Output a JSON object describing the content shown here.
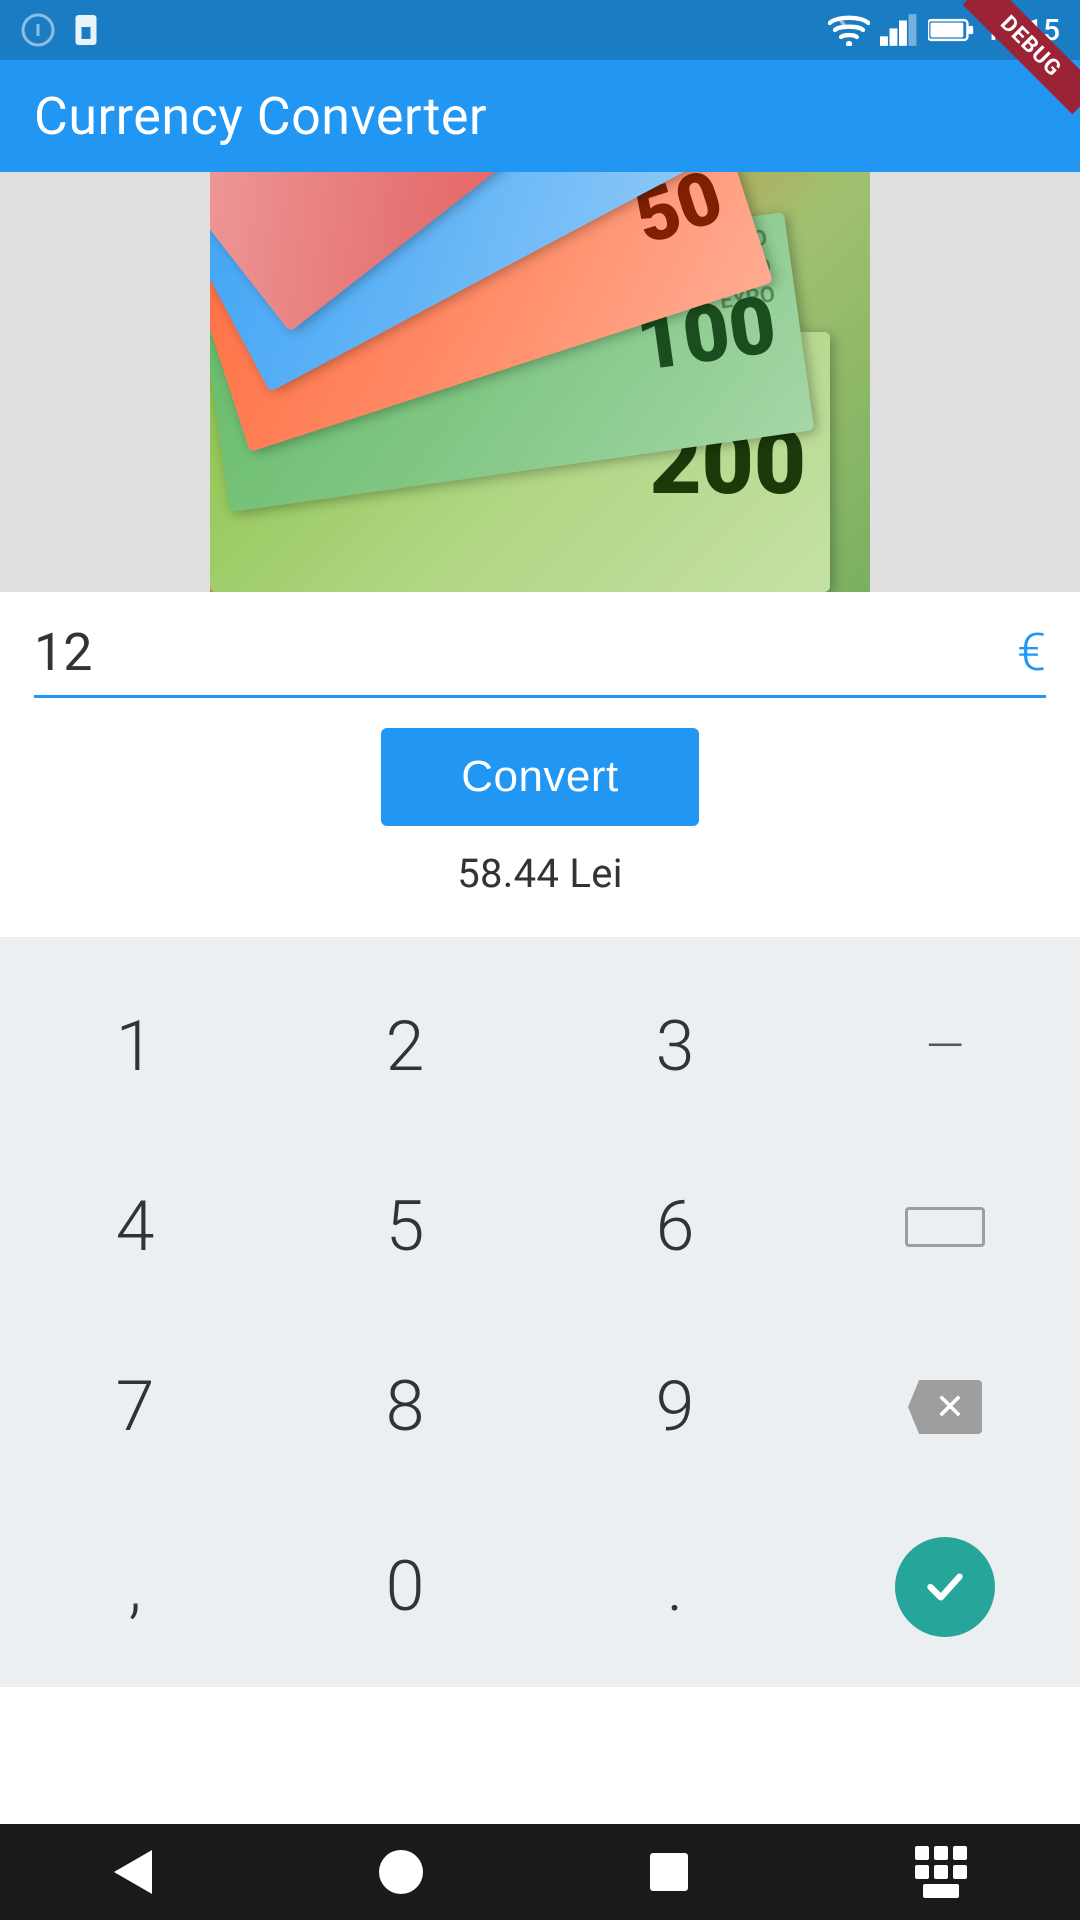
{
  "app": {
    "title": "Currency Converter",
    "debug_label": "DEBUG"
  },
  "status_bar": {
    "time": "10:15",
    "icons": [
      "wifi",
      "signal",
      "battery"
    ]
  },
  "input": {
    "amount": "12",
    "currency_symbol": "€",
    "placeholder": ""
  },
  "convert_button": {
    "label": "Convert"
  },
  "result": {
    "text": "58.44 Lei"
  },
  "keyboard": {
    "rows": [
      [
        "1",
        "2",
        "3",
        "—"
      ],
      [
        "4",
        "5",
        "6",
        "⌴"
      ],
      [
        "7",
        "8",
        "9",
        "⌫"
      ],
      [
        ",",
        "0",
        ".",
        "✓"
      ]
    ]
  },
  "nav": {
    "back_label": "Back",
    "home_label": "Home",
    "recents_label": "Recents",
    "keyboard_label": "Keyboard"
  }
}
